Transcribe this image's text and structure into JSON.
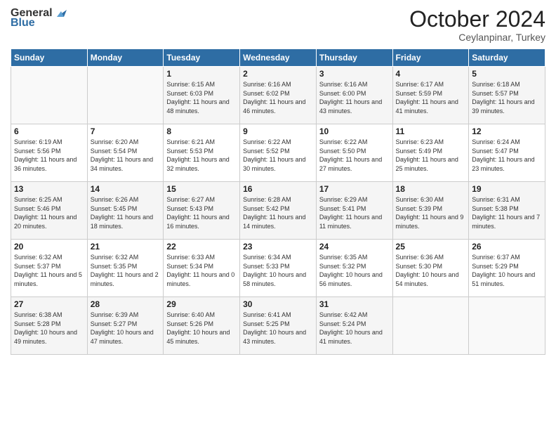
{
  "logo": {
    "line1": "General",
    "line2": "Blue"
  },
  "header": {
    "month": "October 2024",
    "location": "Ceylanpinar, Turkey"
  },
  "weekdays": [
    "Sunday",
    "Monday",
    "Tuesday",
    "Wednesday",
    "Thursday",
    "Friday",
    "Saturday"
  ],
  "weeks": [
    [
      {
        "day": "",
        "info": ""
      },
      {
        "day": "",
        "info": ""
      },
      {
        "day": "1",
        "info": "Sunrise: 6:15 AM\nSunset: 6:03 PM\nDaylight: 11 hours and 48 minutes."
      },
      {
        "day": "2",
        "info": "Sunrise: 6:16 AM\nSunset: 6:02 PM\nDaylight: 11 hours and 46 minutes."
      },
      {
        "day": "3",
        "info": "Sunrise: 6:16 AM\nSunset: 6:00 PM\nDaylight: 11 hours and 43 minutes."
      },
      {
        "day": "4",
        "info": "Sunrise: 6:17 AM\nSunset: 5:59 PM\nDaylight: 11 hours and 41 minutes."
      },
      {
        "day": "5",
        "info": "Sunrise: 6:18 AM\nSunset: 5:57 PM\nDaylight: 11 hours and 39 minutes."
      }
    ],
    [
      {
        "day": "6",
        "info": "Sunrise: 6:19 AM\nSunset: 5:56 PM\nDaylight: 11 hours and 36 minutes."
      },
      {
        "day": "7",
        "info": "Sunrise: 6:20 AM\nSunset: 5:54 PM\nDaylight: 11 hours and 34 minutes."
      },
      {
        "day": "8",
        "info": "Sunrise: 6:21 AM\nSunset: 5:53 PM\nDaylight: 11 hours and 32 minutes."
      },
      {
        "day": "9",
        "info": "Sunrise: 6:22 AM\nSunset: 5:52 PM\nDaylight: 11 hours and 30 minutes."
      },
      {
        "day": "10",
        "info": "Sunrise: 6:22 AM\nSunset: 5:50 PM\nDaylight: 11 hours and 27 minutes."
      },
      {
        "day": "11",
        "info": "Sunrise: 6:23 AM\nSunset: 5:49 PM\nDaylight: 11 hours and 25 minutes."
      },
      {
        "day": "12",
        "info": "Sunrise: 6:24 AM\nSunset: 5:47 PM\nDaylight: 11 hours and 23 minutes."
      }
    ],
    [
      {
        "day": "13",
        "info": "Sunrise: 6:25 AM\nSunset: 5:46 PM\nDaylight: 11 hours and 20 minutes."
      },
      {
        "day": "14",
        "info": "Sunrise: 6:26 AM\nSunset: 5:45 PM\nDaylight: 11 hours and 18 minutes."
      },
      {
        "day": "15",
        "info": "Sunrise: 6:27 AM\nSunset: 5:43 PM\nDaylight: 11 hours and 16 minutes."
      },
      {
        "day": "16",
        "info": "Sunrise: 6:28 AM\nSunset: 5:42 PM\nDaylight: 11 hours and 14 minutes."
      },
      {
        "day": "17",
        "info": "Sunrise: 6:29 AM\nSunset: 5:41 PM\nDaylight: 11 hours and 11 minutes."
      },
      {
        "day": "18",
        "info": "Sunrise: 6:30 AM\nSunset: 5:39 PM\nDaylight: 11 hours and 9 minutes."
      },
      {
        "day": "19",
        "info": "Sunrise: 6:31 AM\nSunset: 5:38 PM\nDaylight: 11 hours and 7 minutes."
      }
    ],
    [
      {
        "day": "20",
        "info": "Sunrise: 6:32 AM\nSunset: 5:37 PM\nDaylight: 11 hours and 5 minutes."
      },
      {
        "day": "21",
        "info": "Sunrise: 6:32 AM\nSunset: 5:35 PM\nDaylight: 11 hours and 2 minutes."
      },
      {
        "day": "22",
        "info": "Sunrise: 6:33 AM\nSunset: 5:34 PM\nDaylight: 11 hours and 0 minutes."
      },
      {
        "day": "23",
        "info": "Sunrise: 6:34 AM\nSunset: 5:33 PM\nDaylight: 10 hours and 58 minutes."
      },
      {
        "day": "24",
        "info": "Sunrise: 6:35 AM\nSunset: 5:32 PM\nDaylight: 10 hours and 56 minutes."
      },
      {
        "day": "25",
        "info": "Sunrise: 6:36 AM\nSunset: 5:30 PM\nDaylight: 10 hours and 54 minutes."
      },
      {
        "day": "26",
        "info": "Sunrise: 6:37 AM\nSunset: 5:29 PM\nDaylight: 10 hours and 51 minutes."
      }
    ],
    [
      {
        "day": "27",
        "info": "Sunrise: 6:38 AM\nSunset: 5:28 PM\nDaylight: 10 hours and 49 minutes."
      },
      {
        "day": "28",
        "info": "Sunrise: 6:39 AM\nSunset: 5:27 PM\nDaylight: 10 hours and 47 minutes."
      },
      {
        "day": "29",
        "info": "Sunrise: 6:40 AM\nSunset: 5:26 PM\nDaylight: 10 hours and 45 minutes."
      },
      {
        "day": "30",
        "info": "Sunrise: 6:41 AM\nSunset: 5:25 PM\nDaylight: 10 hours and 43 minutes."
      },
      {
        "day": "31",
        "info": "Sunrise: 6:42 AM\nSunset: 5:24 PM\nDaylight: 10 hours and 41 minutes."
      },
      {
        "day": "",
        "info": ""
      },
      {
        "day": "",
        "info": ""
      }
    ]
  ]
}
